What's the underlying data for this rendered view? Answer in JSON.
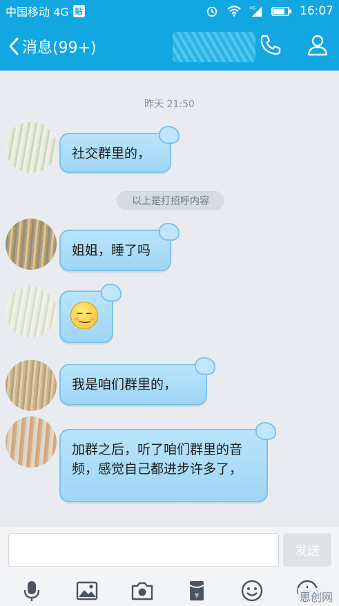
{
  "status_bar": {
    "carrier": "中国移动 4G",
    "badge": "贴",
    "network": "4G",
    "time": "16:07"
  },
  "title_bar": {
    "back_label": "消息(99+)"
  },
  "chat": {
    "timestamp": "昨天 21:50",
    "system_notice": "以上是打招呼内容",
    "messages": [
      {
        "text": "社交群里的，"
      },
      {
        "text": "姐姐，睡了吗"
      },
      {
        "text": ""
      },
      {
        "text": "我是咱们群里的，"
      },
      {
        "text": "加群之后，听了咱们群里的音频，感觉自己都进步许多了，"
      }
    ]
  },
  "input": {
    "placeholder": "",
    "send_label": "发送"
  },
  "watermark": "思创网",
  "colors": {
    "accent": "#12a7e0",
    "bubble": "#aadcf7",
    "bubble_border": "#7fc1ea"
  }
}
